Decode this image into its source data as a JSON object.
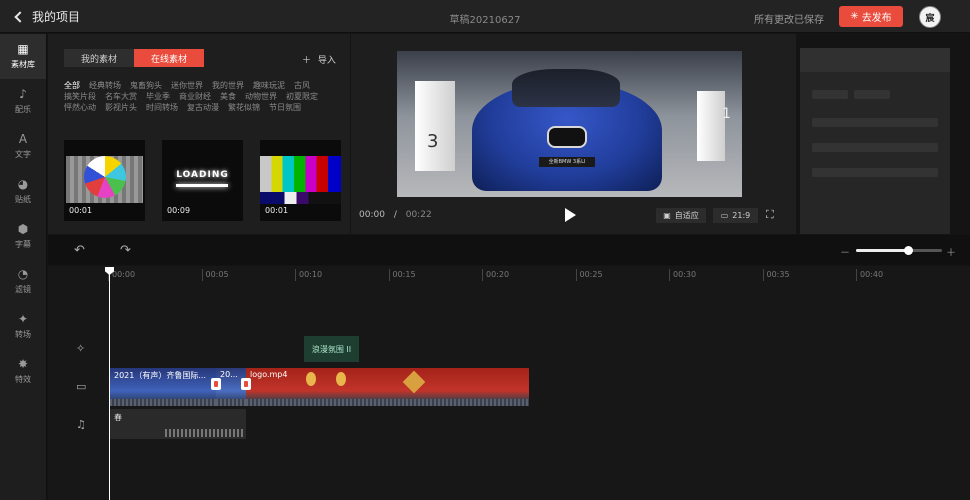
{
  "header": {
    "back_label": "我的项目",
    "draft_title": "草稿20210627",
    "save_status": "所有更改已保存",
    "publish_label": "去发布",
    "avatar_text": "宸"
  },
  "sidebar": {
    "items": [
      {
        "label": "素材库",
        "icon": "grid-icon",
        "glyph": "▦"
      },
      {
        "label": "配乐",
        "icon": "music-note-icon",
        "glyph": "♪"
      },
      {
        "label": "文字",
        "icon": "text-icon",
        "glyph": "A"
      },
      {
        "label": "贴纸",
        "icon": "sticker-icon",
        "glyph": "◕"
      },
      {
        "label": "字幕",
        "icon": "subtitle-icon",
        "glyph": "⬢"
      },
      {
        "label": "滤镜",
        "icon": "filter-icon",
        "glyph": "◔"
      },
      {
        "label": "转场",
        "icon": "transition-icon",
        "glyph": "✦"
      },
      {
        "label": "特效",
        "icon": "effects-icon",
        "glyph": "✸"
      }
    ]
  },
  "assets": {
    "tabs": [
      "我的素材",
      "在线素材"
    ],
    "active_tab_index": 1,
    "import_label": "导入",
    "categories": [
      "全部",
      "经典转场",
      "鬼畜狗头",
      "迷你世界",
      "我的世界",
      "趣味玩泥",
      "古风",
      "搞笑片段",
      "名车大赏",
      "毕业季",
      "商业财经",
      "美食",
      "动物世界",
      "初夏限定",
      "怦然心动",
      "影视片头",
      "时间转场",
      "复古动漫",
      "繁花似锦",
      "节日氛围"
    ],
    "thumbnails": [
      {
        "duration": "00:01"
      },
      {
        "duration": "00:09",
        "overlay_text": "LOADING"
      },
      {
        "duration": "00:01"
      }
    ]
  },
  "player": {
    "current_time": "00:00",
    "separator": "/",
    "total_time": "00:22",
    "fit_label": "自适应",
    "ratio_label": "21:9",
    "video_plate": "全新BMW 3系LI"
  },
  "timeline": {
    "ticks": [
      "00:00",
      "00:05",
      "00:10",
      "00:15",
      "00:20",
      "00:25",
      "00:30",
      "00:35",
      "00:40"
    ],
    "zoom_level": 0.6,
    "effect_clip_label": "浪漫氛围 II",
    "video_clips": [
      "2021（有声）齐鲁国际...",
      "20...",
      "logo.mp4"
    ],
    "audio_clip_label": "春"
  },
  "colors": {
    "accent": "#e94b3c",
    "background": "#141414",
    "panel": "#1e1e1e"
  }
}
